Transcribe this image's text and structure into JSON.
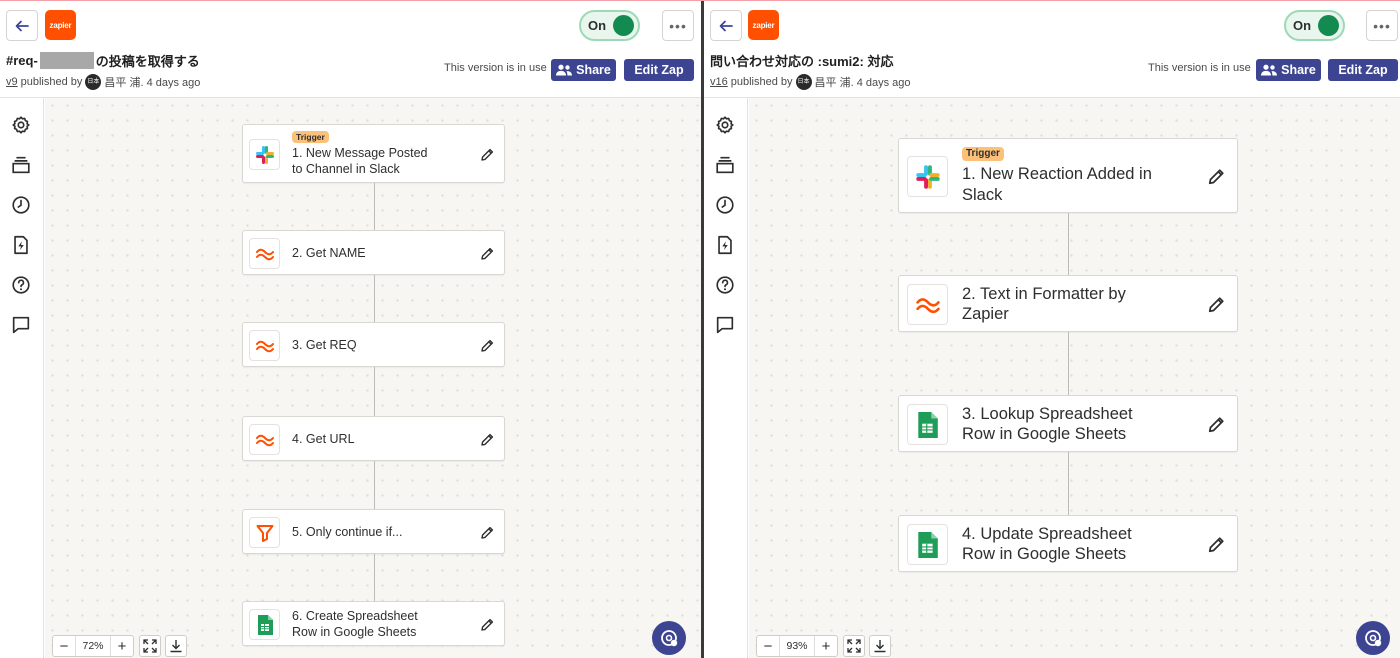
{
  "left": {
    "toggle": "On",
    "title_prefix": "#req-",
    "title_suffix": "の投稿を取得する",
    "version": "v9",
    "published_by": "published by",
    "avatar_initials": "日本",
    "author_info": "昌平 浦. 4 days ago",
    "in_use_text": "This version is in use",
    "share_label": "Share",
    "edit_label": "Edit Zap",
    "zoom": "72%",
    "steps": [
      {
        "label": "1. New Message Posted\nto Channel in Slack",
        "icon": "slack-icon",
        "trigger": "Trigger"
      },
      {
        "label": "2. Get NAME",
        "icon": "formatter-icon"
      },
      {
        "label": "3. Get REQ",
        "icon": "formatter-icon"
      },
      {
        "label": "4. Get URL",
        "icon": "formatter-icon"
      },
      {
        "label": "5. Only continue if...",
        "icon": "filter-icon"
      },
      {
        "label": "6. Create Spreadsheet\nRow in Google Sheets",
        "icon": "google-sheets-icon"
      }
    ]
  },
  "right": {
    "toggle": "On",
    "title": "問い合わせ対応の :sumi2: 対応",
    "version": "v16",
    "published_by": "published by",
    "avatar_initials": "日本",
    "author_info": "昌平 浦. 4 days ago",
    "in_use_text": "This version is in use",
    "share_label": "Share",
    "edit_label": "Edit Zap",
    "zoom": "93%",
    "steps": [
      {
        "label": "1. New Reaction Added in\nSlack",
        "icon": "slack-icon",
        "trigger": "Trigger"
      },
      {
        "label": "2. Text in Formatter by\nZapier",
        "icon": "formatter-icon"
      },
      {
        "label": "3. Lookup Spreadsheet\nRow in Google Sheets",
        "icon": "google-sheets-icon"
      },
      {
        "label": "4. Update Spreadsheet\nRow in Google Sheets",
        "icon": "google-sheets-icon"
      }
    ]
  },
  "logo_text": "zapier",
  "colors": {
    "zapier_orange": "#ff4f00",
    "button_blue": "#3d4592",
    "toggle_green": "#138a50",
    "trigger_badge": "#fbc079",
    "canvas_bg": "#f7f6f3",
    "sheets_green": "#1e9d58"
  },
  "rail_icons": [
    "gear-icon",
    "versions-icon",
    "history-icon",
    "zap-runs-icon",
    "help-icon",
    "comment-icon"
  ]
}
